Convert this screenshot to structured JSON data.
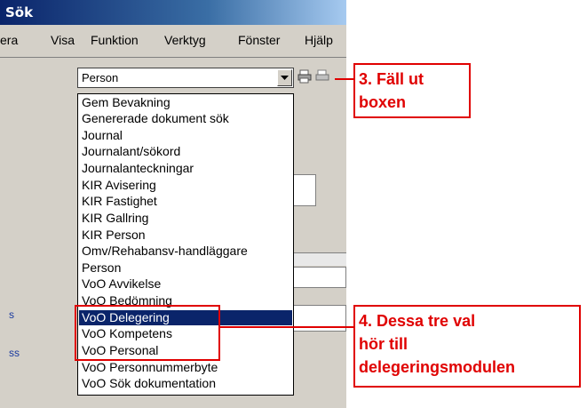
{
  "window": {
    "title": "Sök"
  },
  "menu": [
    "era",
    "Visa",
    "Funktion",
    "Verktyg",
    "Fönster",
    "Hjälp"
  ],
  "combo": {
    "value": "Person"
  },
  "dropdown": {
    "options": [
      "Gem Bevakning",
      "Genererade dokument sök",
      "Journal",
      "Journalant/sökord",
      "Journalanteckningar",
      "KIR Avisering",
      "KIR Fastighet",
      "KIR Gallring",
      "KIR Person",
      "Omv/Rehabansv-handläggare",
      "Person",
      "VoO Avvikelse",
      "VoO Bedömning",
      "VoO Delegering",
      "VoO Kompetens",
      "VoO Personal",
      "VoO Personnummerbyte",
      "VoO Sök dokumentation"
    ],
    "selected_index": 13
  },
  "background_labels": [
    "s",
    "ss"
  ],
  "callouts": {
    "step3": {
      "line1": "3. Fäll ut",
      "line2": "boxen"
    },
    "step4": {
      "line1": "4. Dessa tre val",
      "line2": "hör till",
      "line3": "delegeringsmodulen"
    }
  },
  "colors": {
    "selection": "#0a246a",
    "callout_red": "#e00000",
    "title_bar": "#0a246a"
  },
  "icons": [
    "dropdown-arrow-icon",
    "print-icon",
    "print-preview-icon"
  ]
}
